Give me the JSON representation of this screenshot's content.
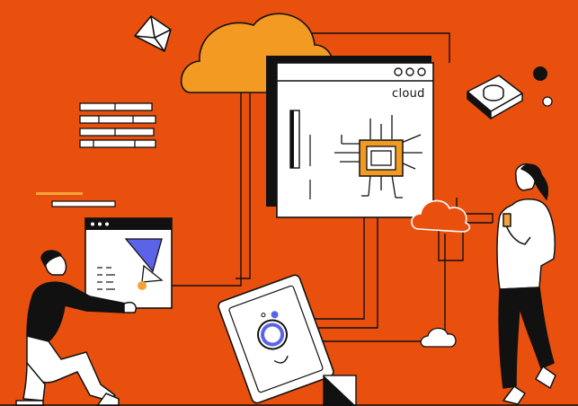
{
  "illustration": {
    "window_label": "cloud",
    "colors": {
      "background": "#E9500E",
      "cloud": "#F39A23",
      "ink": "#111111",
      "paper": "#FFFFFF",
      "chip": "#F39A23",
      "accent_blue": "#5B63E8",
      "accent_orange": "#F6A23A"
    }
  }
}
